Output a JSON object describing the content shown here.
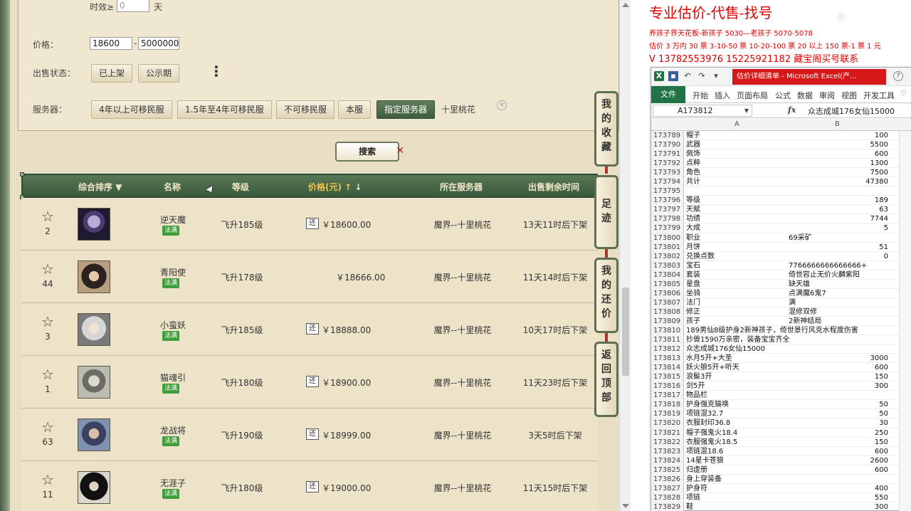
{
  "filters": {
    "time_label": "时效≥",
    "time_value": "0",
    "time_unit": "天",
    "price_label": "价格：",
    "price_min": "18600",
    "price_sep": "-",
    "price_max": "5000000",
    "status_label": "出售状态：",
    "status_options": [
      "已上架",
      "公示期"
    ],
    "server_label": "服务器：",
    "server_options": [
      "4年以上可移民服",
      "1.5年至4年可移民服",
      "不可移民服",
      "本服",
      "指定服务器"
    ],
    "selected_server": "十里桃花"
  },
  "search_label": "搜索",
  "table": {
    "headers": {
      "sort": "综合排序",
      "name": "名称",
      "level": "等级",
      "price": "价格(元)",
      "server": "所在服务器",
      "remain": "出售剩余时间"
    },
    "rows": [
      {
        "count": "2",
        "name": "逆天魔",
        "badge": "法满",
        "level": "飞升185级",
        "haggle": "还",
        "price": "￥18600.00",
        "server": "魔界--十里桃花",
        "remain": "13天11时后下架"
      },
      {
        "count": "44",
        "name": "青阳使",
        "badge": "法满",
        "level": "飞升178级",
        "haggle": "",
        "price": "￥18666.00",
        "server": "魔界--十里桃花",
        "remain": "11天14时后下架"
      },
      {
        "count": "3",
        "name": "小蛮妖",
        "badge": "法满",
        "level": "飞升185级",
        "haggle": "还",
        "price": "￥18888.00",
        "server": "魔界--十里桃花",
        "remain": "10天17时后下架"
      },
      {
        "count": "1",
        "name": "猫魂引",
        "badge": "法满",
        "level": "飞升180级",
        "haggle": "还",
        "price": "￥18900.00",
        "server": "魔界--十里桃花",
        "remain": "11天23时后下架"
      },
      {
        "count": "63",
        "name": "龙战将",
        "badge": "法满",
        "level": "飞升190级",
        "haggle": "还",
        "price": "￥18999.00",
        "server": "魔界--十里桃花",
        "remain": "3天5时后下架"
      },
      {
        "count": "11",
        "name": "无涯子",
        "badge": "法满",
        "level": "飞升180级",
        "haggle": "还",
        "price": "￥19000.00",
        "server": "魔界--十里桃花",
        "remain": "11天15时后下架"
      }
    ]
  },
  "side_tabs": [
    {
      "label": [
        "我",
        "的",
        "收",
        "藏"
      ]
    },
    {
      "label": [
        "足",
        "迹"
      ]
    },
    {
      "label": [
        "我",
        "的",
        "还",
        "价"
      ]
    },
    {
      "label": [
        "返",
        "回",
        "顶",
        "部"
      ]
    }
  ],
  "ad": {
    "title": "专业估价-代售-找号",
    "line1": "养孩子界天花板-新孩子 5030—老孩子 5070-5078",
    "line2": "估价 3 万内 30 票  3-10-50 票  10-20-100 票 20 以上 150 票-1 票 1 元",
    "phone": "V 13782553976    15225921182   藏宝阁买号联系"
  },
  "excel": {
    "window_title": "估价详细清单 - Microsoft Excel(产...",
    "tabs": [
      "文件",
      "开始",
      "插入",
      "页面布局",
      "公式",
      "数据",
      "审阅",
      "视图",
      "开发工具"
    ],
    "name_box": "A173812",
    "fx": "fx",
    "formula": "众志成城176女仙15000",
    "col_a": "A",
    "col_b": "B",
    "rows": [
      {
        "n": "173789",
        "a": "帽子",
        "b": "100"
      },
      {
        "n": "173790",
        "a": "武器",
        "b": "5500"
      },
      {
        "n": "173791",
        "a": "佩饰",
        "b": "600"
      },
      {
        "n": "173792",
        "a": "点粹",
        "b": "1300"
      },
      {
        "n": "173793",
        "a": "角色",
        "b": "7500"
      },
      {
        "n": "173794",
        "a": "共计",
        "b": "47380"
      },
      {
        "n": "173795",
        "a": "",
        "b": ""
      },
      {
        "n": "173796",
        "a": "等级",
        "b": "189"
      },
      {
        "n": "173797",
        "a": "天赋",
        "b": "63"
      },
      {
        "n": "173798",
        "a": "功绩",
        "b": "7744"
      },
      {
        "n": "173799",
        "a": "大成",
        "b": "5"
      },
      {
        "n": "173800",
        "a": "职业",
        "b": "69采矿",
        "t": true
      },
      {
        "n": "173801",
        "a": "月饼",
        "b": "51"
      },
      {
        "n": "173802",
        "a": "兑换点数",
        "b": "0"
      },
      {
        "n": "173803",
        "a": "宝石",
        "b": "7766666666666666+",
        "t": true
      },
      {
        "n": "173804",
        "a": "套装",
        "b": "倚世容止无价火麟紫阳",
        "t": true
      },
      {
        "n": "173805",
        "a": "星盘",
        "b": "缺天雄",
        "t": true
      },
      {
        "n": "173806",
        "a": "坐骑",
        "b": "点满魔6鬼7",
        "t": true
      },
      {
        "n": "173807",
        "a": "法门",
        "b": "满",
        "t": true
      },
      {
        "n": "173808",
        "a": "修正",
        "b": "混修双修",
        "t": true
      },
      {
        "n": "173809",
        "a": "孩子",
        "b": "2新神结局",
        "t": true
      },
      {
        "n": "173810",
        "a": "189男仙8级护身2新神孩子，倚世景行风克水程度伤害",
        "b": "",
        "t": true
      },
      {
        "n": "173811",
        "a": "抄兽1590万亲密，装备宝宝齐全",
        "b": "",
        "t": true
      },
      {
        "n": "173812",
        "a": "众志成城176女仙15000",
        "b": "",
        "t": true
      },
      {
        "n": "173813",
        "a": "水月5开+大圣",
        "b": "3000"
      },
      {
        "n": "173814",
        "a": "妖火狼5开+听天",
        "b": "600"
      },
      {
        "n": "173815",
        "a": "浪鬃3开",
        "b": "150"
      },
      {
        "n": "173816",
        "a": "剑5开",
        "b": "300"
      },
      {
        "n": "173817",
        "a": "物品栏",
        "b": ""
      },
      {
        "n": "173818",
        "a": "护身强克猫唤",
        "b": "50"
      },
      {
        "n": "173819",
        "a": "项链混32.7",
        "b": "50"
      },
      {
        "n": "173820",
        "a": "衣服封印36.8",
        "b": "30"
      },
      {
        "n": "173821",
        "a": "帽子强鬼火18.4",
        "b": "250"
      },
      {
        "n": "173822",
        "a": "衣服强鬼火18.5",
        "b": "150"
      },
      {
        "n": "173823",
        "a": "项链混18.6",
        "b": "600"
      },
      {
        "n": "173824",
        "a": "14星卡苍狼",
        "b": "2600"
      },
      {
        "n": "173825",
        "a": "归虚册",
        "b": "600"
      },
      {
        "n": "173826",
        "a": "身上穿装备",
        "b": ""
      },
      {
        "n": "173827",
        "a": "护身符",
        "b": "400"
      },
      {
        "n": "173828",
        "a": "项链",
        "b": "550"
      },
      {
        "n": "173829",
        "a": "鞋",
        "b": "300"
      }
    ]
  }
}
